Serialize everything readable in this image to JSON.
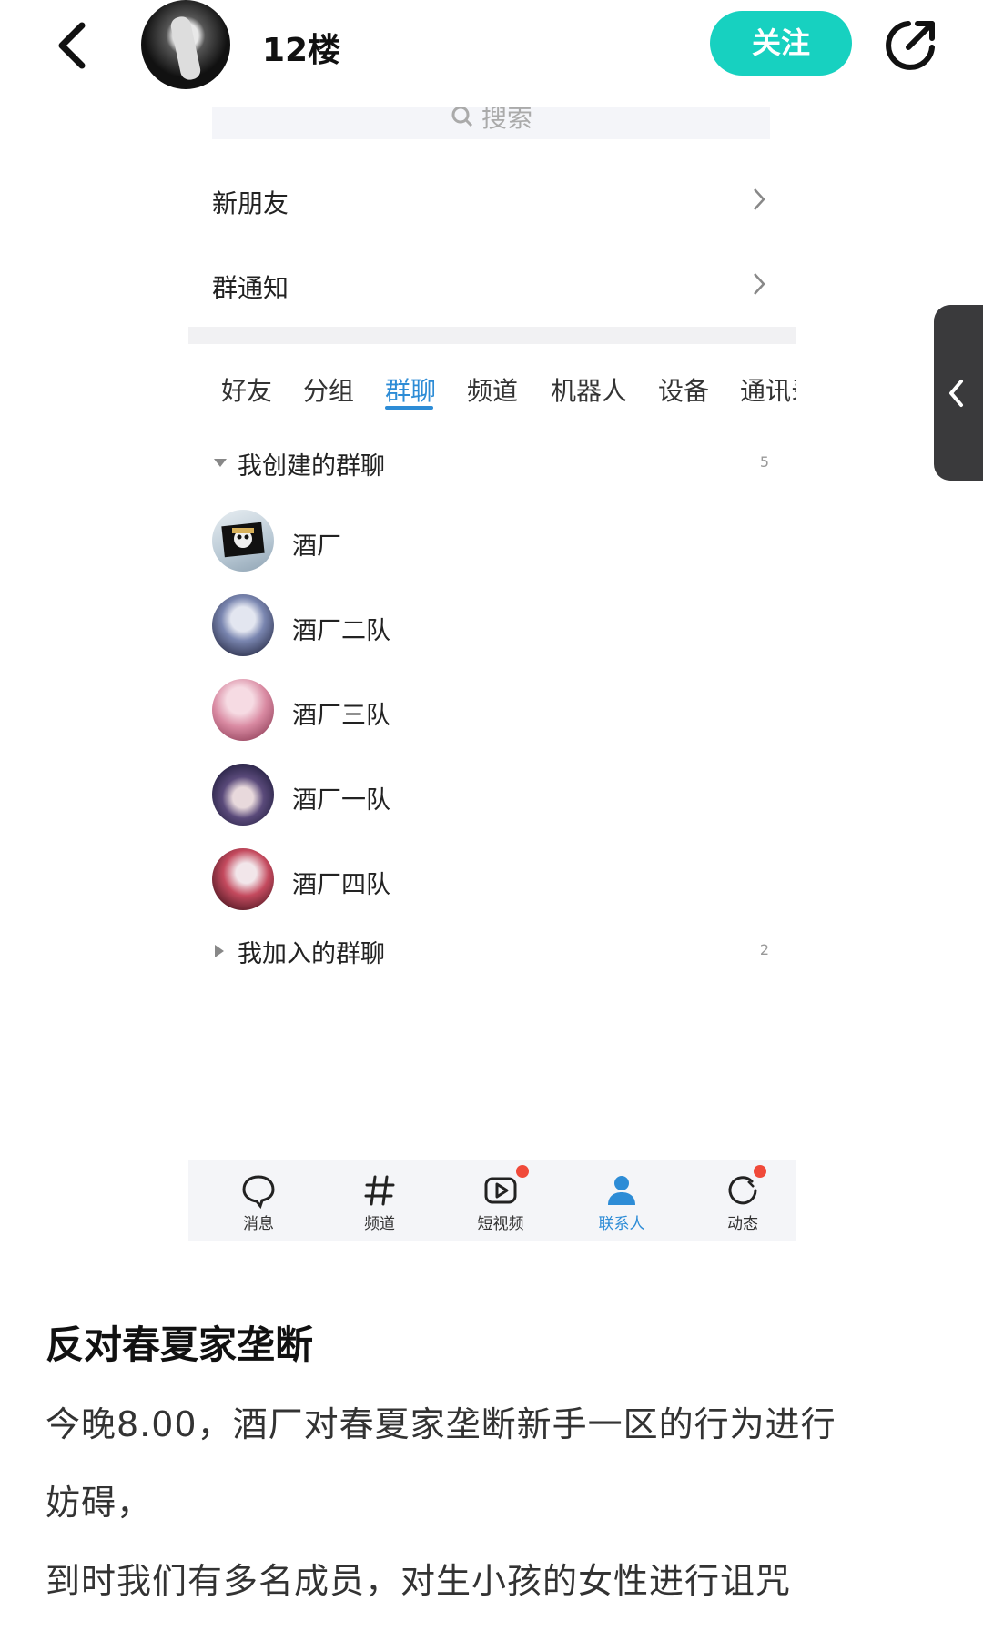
{
  "header": {
    "title": "12楼",
    "follow_label": "关注"
  },
  "search": {
    "placeholder": "搜索"
  },
  "menu": {
    "new_friends": "新朋友",
    "group_notice": "群通知"
  },
  "tabs": [
    "好友",
    "分组",
    "群聊",
    "频道",
    "机器人",
    "设备",
    "通讯录"
  ],
  "active_tab": "群聊",
  "sections": {
    "created": {
      "label": "我创建的群聊",
      "count": "5"
    },
    "joined": {
      "label": "我加入的群聊",
      "count": "2"
    }
  },
  "groups": [
    "酒厂",
    "酒厂二队",
    "酒厂三队",
    "酒厂一队",
    "酒厂四队"
  ],
  "bottom_nav": {
    "messages": "消息",
    "channels": "频道",
    "short_video": "短视频",
    "contacts": "联系人",
    "moments": "动态"
  },
  "article": {
    "title": "反对春夏家垄断",
    "lines": [
      "今晚8.00，酒厂对春夏家垄断新手一区的行为进行",
      "妨碍，",
      "到时我们有多名成员，对生小孩的女性进行诅咒"
    ]
  },
  "colors": {
    "follow_button": "#17d1c0",
    "accent_blue": "#2d8cd6",
    "badge_red": "#f04a3a"
  }
}
